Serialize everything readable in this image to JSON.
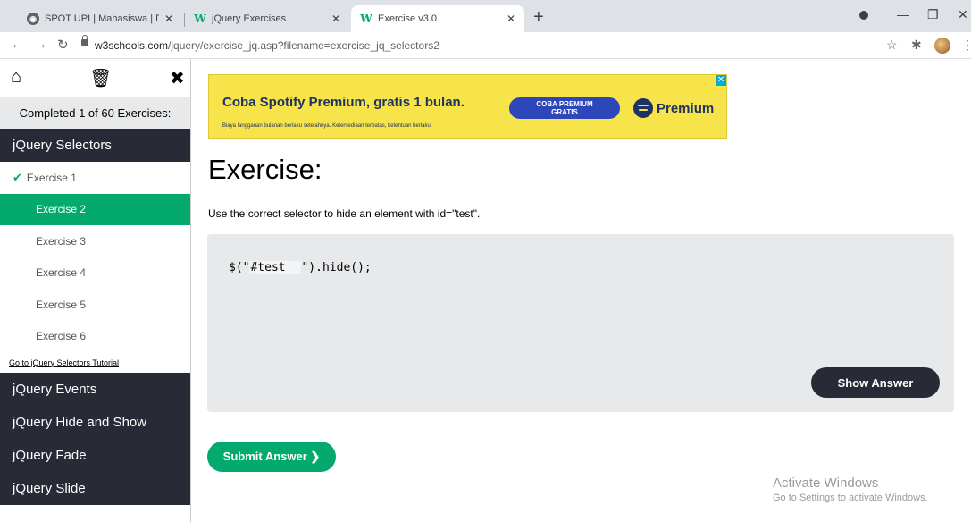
{
  "browser": {
    "tabs": [
      {
        "title": "SPOT UPI | Mahasiswa | Dashboa",
        "close": "✕"
      },
      {
        "title": "jQuery Exercises",
        "close": "✕"
      },
      {
        "title": "Exercise v3.0",
        "close": "✕"
      }
    ],
    "new_tab": "+",
    "url_host": "w3schools.com",
    "url_path": "/jquery/exercise_jq.asp?filename=exercise_jq_selectors2"
  },
  "sidebar": {
    "completed": "Completed 1 of 60 Exercises:",
    "categories": [
      {
        "label": "jQuery Selectors"
      },
      {
        "label": "jQuery Events"
      },
      {
        "label": "jQuery Hide and Show"
      },
      {
        "label": "jQuery Fade"
      },
      {
        "label": "jQuery Slide"
      }
    ],
    "exercises": [
      {
        "label": "Exercise 1"
      },
      {
        "label": "Exercise 2"
      },
      {
        "label": "Exercise 3"
      },
      {
        "label": "Exercise 4"
      },
      {
        "label": "Exercise 5"
      },
      {
        "label": "Exercise 6"
      }
    ],
    "tutorial_link": "Go to jQuery Selectors Tutorial"
  },
  "ad": {
    "headline": "Coba Spotify Premium, gratis 1 bulan.",
    "fine_print": "Biaya langganan bulanan berlaku setelahnya. Ketersediaan terbatas, ketentuan berlaku.",
    "cta_line1": "COBA PREMIUM",
    "cta_line2": "GRATIS",
    "brand": "Premium",
    "close": "✕"
  },
  "exercise": {
    "heading": "Exercise:",
    "instruction": "Use the correct selector to hide an element with id=\"test\".",
    "code_prefix": "$(\"",
    "input_value": "#test",
    "code_suffix": "\").hide();",
    "show_answer": "Show Answer",
    "submit": "Submit Answer ❯"
  },
  "watermark": {
    "line1": "Activate Windows",
    "line2": "Go to Settings to activate Windows."
  }
}
